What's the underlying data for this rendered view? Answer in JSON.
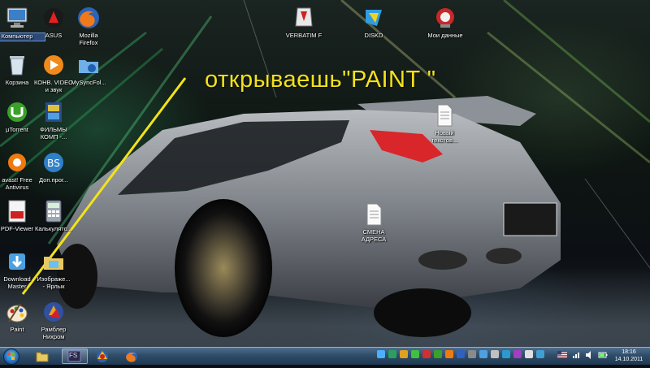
{
  "annotation": {
    "text": "открываешь\"PAINT \""
  },
  "desktop_icons": [
    {
      "id": "computer",
      "label": "Компьютер",
      "icon": "computer-icon"
    },
    {
      "id": "asus",
      "label": "ASUS",
      "icon": "asus-icon"
    },
    {
      "id": "firefox",
      "label": "Mozilla\nFirefox",
      "icon": "firefox-icon"
    },
    {
      "id": "verbatim",
      "label": "VERBATIM F",
      "icon": "verbatim-icon"
    },
    {
      "id": "disk_d",
      "label": "DISKD",
      "icon": "drive-icon"
    },
    {
      "id": "my_data",
      "label": "Мои данные",
      "icon": "my-data-icon"
    },
    {
      "id": "recycle",
      "label": "Корзина",
      "icon": "recycle-bin-icon"
    },
    {
      "id": "video_converter",
      "label": "КОНВ. VIDEO\nи звук",
      "icon": "video-converter-icon"
    },
    {
      "id": "mysyncfolder",
      "label": "MySyncFol...",
      "icon": "sync-folder-icon"
    },
    {
      "id": "utorrent",
      "label": "µTorrent",
      "icon": "utorrent-icon"
    },
    {
      "id": "films",
      "label": "ФИЛЬМЫ\nКОМП -...",
      "icon": "film-folder-icon"
    },
    {
      "id": "new_text",
      "label": "Новый\nтекстов...",
      "icon": "text-document-icon"
    },
    {
      "id": "avast",
      "label": "avast! Free\nAntivirus",
      "icon": "avast-icon"
    },
    {
      "id": "dop_prog",
      "label": "Доп.прог...",
      "icon": "bs-icon"
    },
    {
      "id": "pdf_viewer",
      "label": "PDF-Viewer",
      "icon": "pdf-icon"
    },
    {
      "id": "calculator",
      "label": "Калькулято...",
      "icon": "calculator-icon"
    },
    {
      "id": "address",
      "label": "СМЕНА\nАДРЕСА",
      "icon": "text-document-icon"
    },
    {
      "id": "download_master",
      "label": "Download\nMaster",
      "icon": "download-master-icon"
    },
    {
      "id": "images_shortcut",
      "label": "Изображе...\n- Ярлык",
      "icon": "images-shortcut-icon"
    },
    {
      "id": "paint",
      "label": "Paint",
      "icon": "paint-icon"
    },
    {
      "id": "rambler",
      "label": "Рамблер\nНихром",
      "icon": "rambler-icon"
    }
  ],
  "taskbar": {
    "items": [
      {
        "id": "explorer",
        "icon": "folder-icon",
        "active": false
      },
      {
        "id": "fs",
        "label": "FS",
        "icon": "fs-icon",
        "active": true
      },
      {
        "id": "chrome",
        "icon": "browser-icon",
        "active": false
      },
      {
        "id": "firefox",
        "icon": "firefox-icon",
        "active": false
      }
    ],
    "clock": {
      "time": "18:16",
      "date": "14.10.2011"
    }
  },
  "colors": {
    "annotation": "#f3e21a",
    "taskbar": "#2f4d69"
  }
}
